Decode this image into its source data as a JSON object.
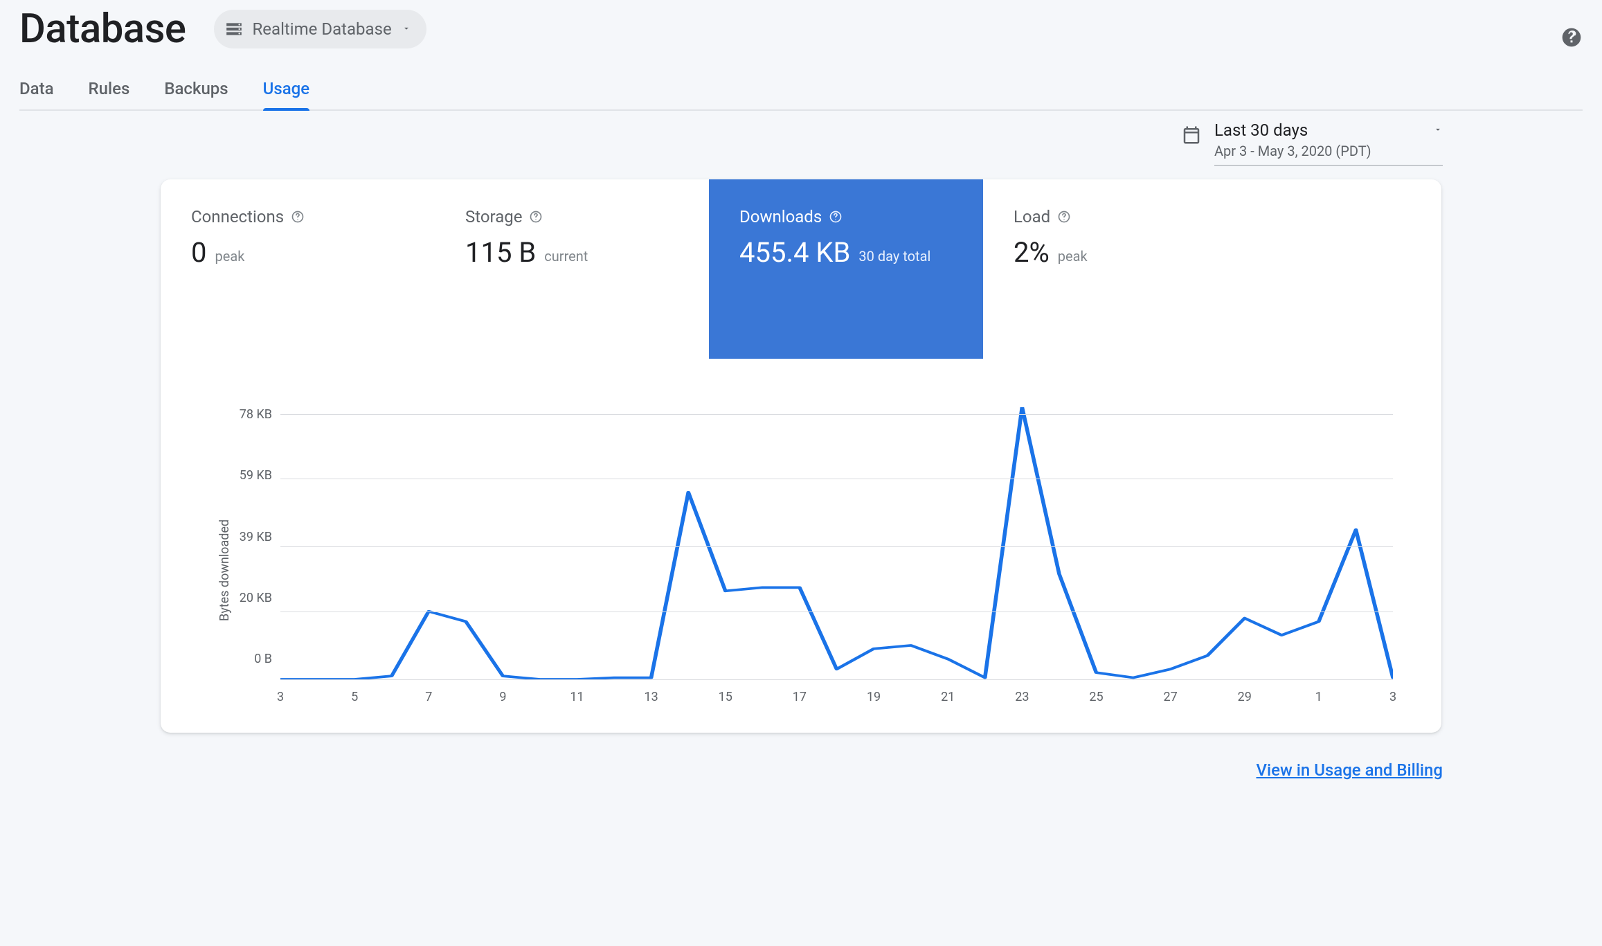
{
  "header": {
    "title": "Database",
    "selector_label": "Realtime Database"
  },
  "tabs": [
    "Data",
    "Rules",
    "Backups",
    "Usage"
  ],
  "active_tab": "Usage",
  "date_range": {
    "label": "Last 30 days",
    "sub": "Apr 3 - May 3, 2020 (PDT)"
  },
  "metrics": [
    {
      "key": "connections",
      "label": "Connections",
      "value": "0",
      "sub": "peak",
      "active": false
    },
    {
      "key": "storage",
      "label": "Storage",
      "value": "115 B",
      "sub": "current",
      "active": false
    },
    {
      "key": "downloads",
      "label": "Downloads",
      "value": "455.4 KB",
      "sub": "30 day total",
      "active": true
    },
    {
      "key": "load",
      "label": "Load",
      "value": "2%",
      "sub": "peak",
      "active": false
    }
  ],
  "chart_data": {
    "type": "line",
    "title": "",
    "xlabel": "",
    "ylabel": "Bytes downloaded",
    "y_ticks": [
      "78 KB",
      "59 KB",
      "39 KB",
      "20 KB",
      "0 B"
    ],
    "y_tick_values": [
      78,
      59,
      39,
      20,
      0
    ],
    "x_ticks": [
      "3",
      "5",
      "7",
      "9",
      "11",
      "13",
      "15",
      "17",
      "19",
      "21",
      "23",
      "25",
      "27",
      "29",
      "1",
      "3"
    ],
    "x": [
      3,
      4,
      5,
      6,
      7,
      8,
      9,
      10,
      11,
      12,
      13,
      14,
      15,
      16,
      17,
      18,
      19,
      20,
      21,
      22,
      23,
      24,
      25,
      26,
      27,
      28,
      29,
      30,
      1,
      2,
      3
    ],
    "values": [
      0,
      0,
      0,
      1,
      20,
      17,
      1,
      0,
      0,
      0.5,
      0.5,
      55,
      26,
      27,
      27,
      3,
      9,
      10,
      6,
      0.5,
      80,
      31,
      2,
      0.5,
      3,
      7,
      18,
      13,
      17,
      44,
      0.5
    ],
    "ylim": [
      0,
      80
    ],
    "legend": []
  },
  "link": "View in Usage and Billing",
  "colors": {
    "accent": "#1a73e8",
    "metric_bg": "#3a77d6",
    "muted": "#5f6368"
  }
}
